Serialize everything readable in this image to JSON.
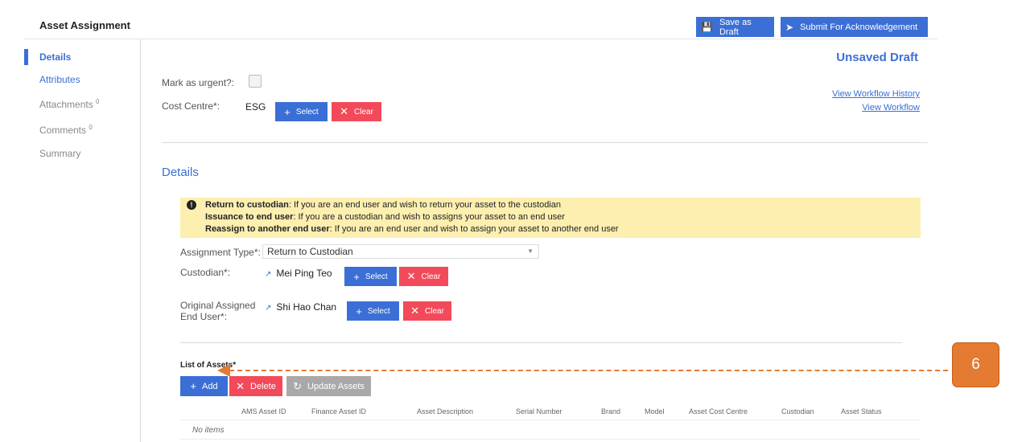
{
  "app": {
    "title": "Asset Assignment",
    "save_draft_label": "Save as Draft",
    "submit_label": "Submit For Acknowledgement"
  },
  "sidebar": {
    "items": [
      {
        "label": "Details",
        "badge": ""
      },
      {
        "label": "Attributes",
        "badge": ""
      },
      {
        "label": "Attachments",
        "badge": "0"
      },
      {
        "label": "Comments",
        "badge": "0"
      },
      {
        "label": "Summary",
        "badge": ""
      }
    ]
  },
  "form": {
    "urgent_label": "Mark as urgent?:",
    "cost_centre_label": "Cost Centre*:",
    "cost_centre_value": "ESG",
    "select_label": "Select",
    "clear_label": "Clear"
  },
  "status": {
    "draft": "Unsaved Draft",
    "history_link": "View Workflow History",
    "workflow_link": "View Workflow"
  },
  "details": {
    "title": "Details",
    "notice": [
      {
        "bold": "Return to custodian",
        "text": ": If you are an end user and wish to return your asset to the custodian"
      },
      {
        "bold": "Issuance to end user",
        "text": ": If you are a custodian and wish to assigns your asset to an end user"
      },
      {
        "bold": "Reassign to another end user",
        "text": ": If you are an end user and wish to assign your asset to another end user"
      }
    ],
    "assignment_type_label": "Assignment Type*:",
    "assignment_type_value": "Return to Custodian",
    "custodian_label": "Custodian*:",
    "custodian_value": "Mei Ping Teo",
    "original_user_label_1": "Original Assigned",
    "original_user_label_2": "End User*:",
    "original_user_value": "Shi Hao Chan"
  },
  "assets": {
    "title": "List of Assets*",
    "add_label": "Add",
    "delete_label": "Delete",
    "update_label": "Update Assets",
    "columns": [
      "AMS Asset ID",
      "Finance Asset ID",
      "Asset Description",
      "Serial Number",
      "Brand",
      "Model",
      "Asset Cost Centre",
      "Custodian",
      "Asset Status"
    ],
    "empty_text": "No items"
  },
  "callout": {
    "number": "6",
    "color": "#e57a32"
  },
  "colors": {
    "primary": "#3b6fd6",
    "danger": "#f24a5a",
    "notice": "#fdefb0"
  }
}
